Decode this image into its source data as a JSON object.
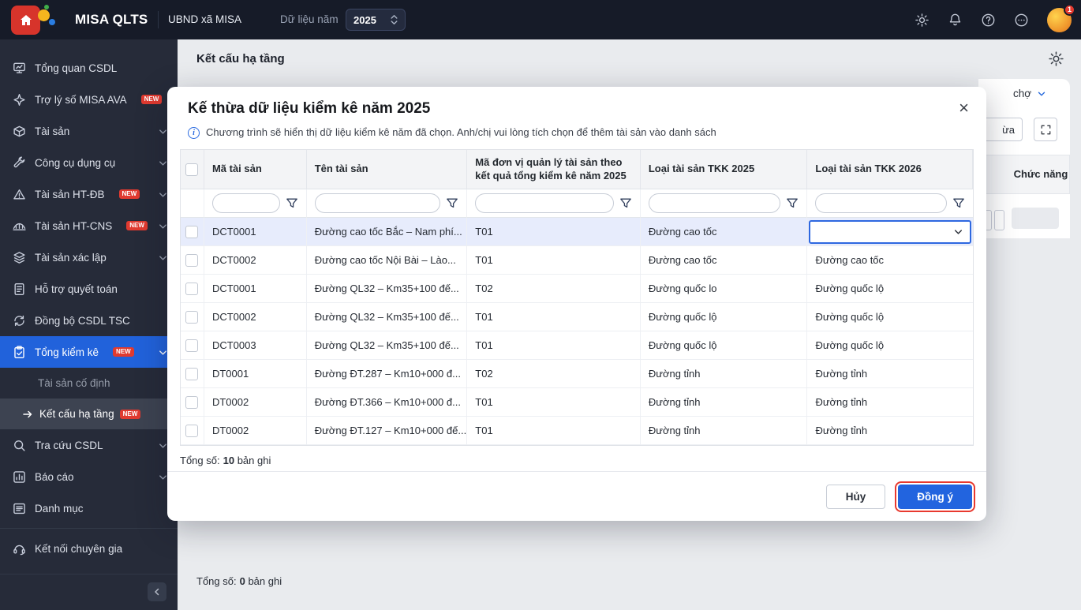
{
  "header": {
    "brand": "MISA QLTS",
    "org": "UBND xã MISA",
    "year_label": "Dữ liệu năm",
    "year_value": "2025",
    "avatar_badge": "1"
  },
  "sidebar": {
    "items": [
      {
        "label": "Tổng quan CSDL"
      },
      {
        "label": "Trợ lý số MISA AVA",
        "badge": "NEW"
      },
      {
        "label": "Tài sản"
      },
      {
        "label": "Công cụ dụng cụ"
      },
      {
        "label": "Tài sản HT-ĐB",
        "badge": "NEW"
      },
      {
        "label": "Tài sản HT-CNS",
        "badge": "NEW"
      },
      {
        "label": "Tài sản xác lập"
      },
      {
        "label": "Hỗ trợ quyết toán"
      },
      {
        "label": "Đồng bộ CSDL TSC"
      },
      {
        "label": "Tổng kiểm kê",
        "badge": "NEW"
      },
      {
        "label": "Tài sản cố định"
      },
      {
        "label": "Kết cấu hạ tầng",
        "badge": "NEW"
      },
      {
        "label": "Tra cứu CSDL"
      },
      {
        "label": "Báo cáo"
      },
      {
        "label": "Danh mục"
      },
      {
        "label": "Kết nối chuyên gia"
      }
    ]
  },
  "page": {
    "title": "Kết cấu hạ tầng",
    "fragments": {
      "dropdown_text": "chợ",
      "button_fragment": "ừa",
      "column_header": "Chức năng"
    },
    "total_label": "Tổng số:",
    "total_count": "0",
    "total_unit": "bản ghi"
  },
  "modal": {
    "title": "Kế thừa dữ liệu kiểm kê năm 2025",
    "info": "Chương trình sẽ hiển thị dữ liệu kiểm kê năm đã chọn. Anh/chị vui lòng tích chọn để thêm tài sản vào danh sách",
    "table": {
      "columns": [
        "Mã tài sản",
        "Tên tài sản",
        "Mã đơn vị quản lý tài sản theo kết quả tổng kiểm kê năm 2025",
        "Loại tài sản TKK 2025",
        "Loại tài sản TKK 2026"
      ],
      "rows": [
        {
          "code": "DCT0001",
          "name": "Đường cao tốc Bắc – Nam phí...",
          "unit": "T01",
          "t25": "Đường cao tốc",
          "t26": ""
        },
        {
          "code": "DCT0002",
          "name": "Đường cao tốc Nội Bài – Lào...",
          "unit": "T01",
          "t25": "Đường cao tốc",
          "t26": "Đường cao tốc"
        },
        {
          "code": "DCT0001",
          "name": "Đường QL32 – Km35+100 đế...",
          "unit": "T02",
          "t25": "Đường quốc lo",
          "t26": "Đường quốc lộ"
        },
        {
          "code": "DCT0002",
          "name": "Đường QL32 – Km35+100 đế...",
          "unit": "T01",
          "t25": "Đường quốc lộ",
          "t26": "Đường quốc lộ"
        },
        {
          "code": "DCT0003",
          "name": "Đường QL32 – Km35+100 đế...",
          "unit": "T01",
          "t25": "Đường quốc lộ",
          "t26": "Đường quốc lộ"
        },
        {
          "code": "DT0001",
          "name": "Đường ĐT.287 – Km10+000 đ...",
          "unit": "T02",
          "t25": "Đường tỉnh",
          "t26": "Đường tỉnh"
        },
        {
          "code": "DT0002",
          "name": "Đường ĐT.366 – Km10+000 đ...",
          "unit": "T01",
          "t25": "Đường tỉnh",
          "t26": "Đường tỉnh"
        },
        {
          "code": "DT0002",
          "name": "Đường ĐT.127 – Km10+000 đế...",
          "unit": "T01",
          "t25": "Đường tỉnh",
          "t26": "Đường tỉnh"
        }
      ]
    },
    "total_label": "Tổng số:",
    "total_count": "10",
    "total_unit": "bản ghi",
    "cancel_label": "Hủy",
    "ok_label": "Đồng ý"
  }
}
